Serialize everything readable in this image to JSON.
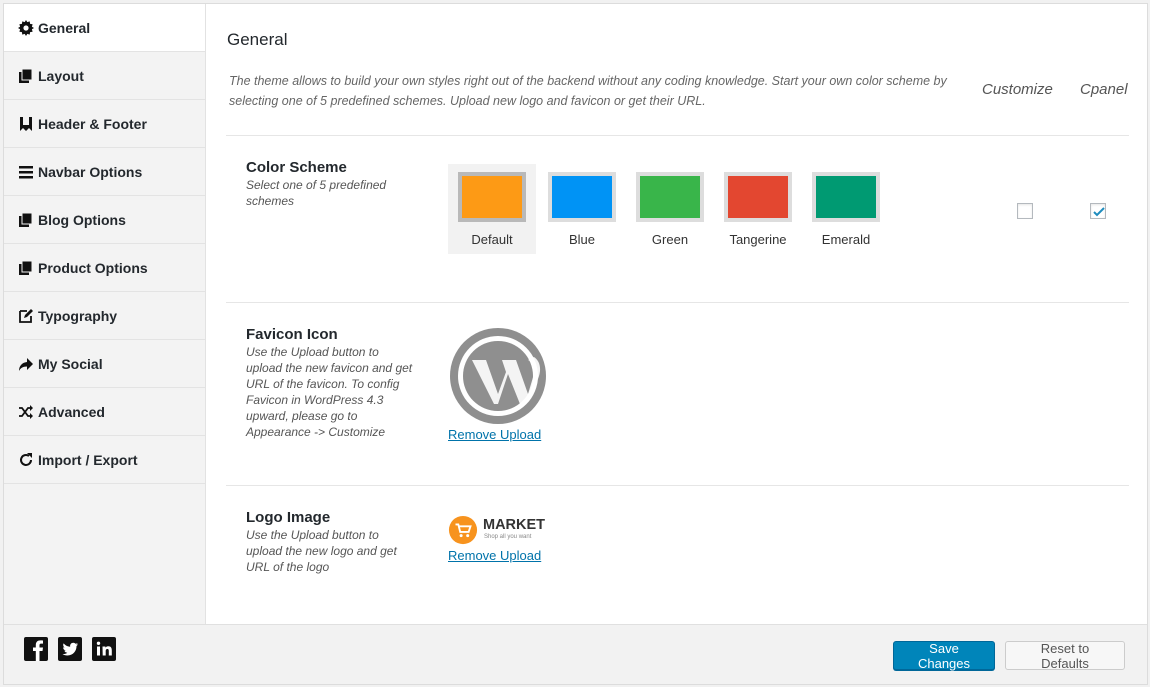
{
  "sidebar": {
    "items": [
      {
        "label": "General",
        "icon": "gear-icon",
        "active": true
      },
      {
        "label": "Layout",
        "icon": "copy-icon"
      },
      {
        "label": "Header & Footer",
        "icon": "bookmark-icon"
      },
      {
        "label": "Navbar Options",
        "icon": "bars-icon"
      },
      {
        "label": "Blog Options",
        "icon": "copy-icon"
      },
      {
        "label": "Product Options",
        "icon": "copy-icon"
      },
      {
        "label": "Typography",
        "icon": "edit-icon"
      },
      {
        "label": "My Social",
        "icon": "share-arrow-icon"
      },
      {
        "label": "Advanced",
        "icon": "shuffle-icon"
      },
      {
        "label": "Import / Export",
        "icon": "refresh-icon"
      }
    ]
  },
  "main": {
    "title": "General",
    "intro": "The theme allows to build your own styles right out of the backend without any coding knowledge. Start your own color scheme by selecting one of 5 predefined schemes. Upload new logo and favicon or get their URL.",
    "columns": {
      "customize": "Customize",
      "cpanel": "Cpanel"
    },
    "color_scheme": {
      "title": "Color Scheme",
      "desc": "Select one of 5 predefined schemes",
      "selected": "Default",
      "swatches": [
        {
          "label": "Default",
          "color": "#fd9a15"
        },
        {
          "label": "Blue",
          "color": "#0093f5"
        },
        {
          "label": "Green",
          "color": "#39b54a"
        },
        {
          "label": "Tangerine",
          "color": "#e34730"
        },
        {
          "label": "Emerald",
          "color": "#009a72"
        }
      ],
      "customize_checked": false,
      "cpanel_checked": true
    },
    "favicon": {
      "title": "Favicon Icon",
      "desc": "Use the Upload button to upload the new favicon and get URL of the favicon. To config Favicon in WordPress 4.3 upward, please go to Appearance -> Customize",
      "remove": "Remove Upload"
    },
    "logo": {
      "title": "Logo Image",
      "desc": "Use the Upload button to upload the new logo and get URL of the logo",
      "brand": "MARKET",
      "tagline": "Shop all you want",
      "remove": "Remove Upload"
    }
  },
  "footer": {
    "social": [
      "facebook-icon",
      "twitter-icon",
      "linkedin-icon"
    ],
    "save_label": "Save Changes",
    "reset_label": "Reset to Defaults"
  },
  "colors": {
    "accent": "#0085ba",
    "link": "#0073aa"
  }
}
